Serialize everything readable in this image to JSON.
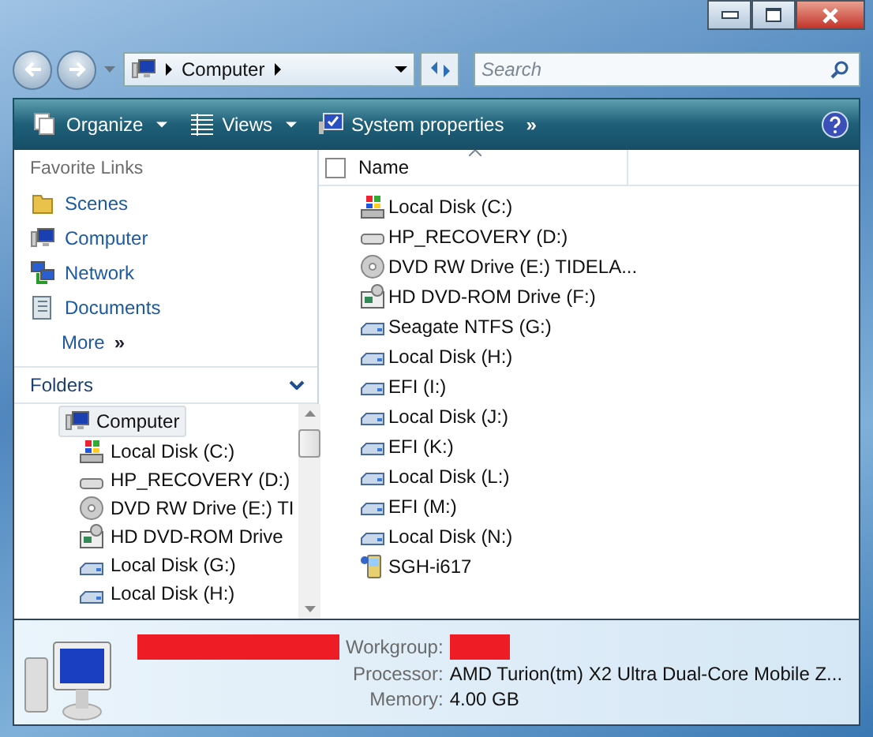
{
  "address_bar": {
    "path": [
      "Computer"
    ]
  },
  "search": {
    "placeholder": "Search"
  },
  "toolbar": [
    {
      "label": "Organize",
      "kind": "organize",
      "dropdown": true
    },
    {
      "label": "Views",
      "kind": "views",
      "dropdown": true
    },
    {
      "label": "System properties",
      "kind": "system",
      "dropdown": false
    },
    {
      "label": "»",
      "kind": "more",
      "dropdown": false
    }
  ],
  "favorite_links": {
    "title": "Favorite Links",
    "items": [
      {
        "label": "Scenes",
        "kind": "folder"
      },
      {
        "label": "Computer",
        "kind": "computer"
      },
      {
        "label": "Network",
        "kind": "network"
      },
      {
        "label": "Documents",
        "kind": "documents"
      }
    ],
    "more": {
      "label": "More",
      "chevron": "»"
    }
  },
  "folders": {
    "title": "Folders",
    "expanded": true,
    "tree": [
      {
        "label": "Computer",
        "kind": "computer",
        "selected": true,
        "children": [
          {
            "label": "Local Disk (C:)",
            "kind": "system-drive",
            "selected": false
          },
          {
            "label": "HP_RECOVERY (D:)",
            "kind": "drive",
            "selected": false
          },
          {
            "label": "DVD RW Drive (E:) TI",
            "kind": "dvd",
            "selected": false
          },
          {
            "label": "HD DVD-ROM Drive",
            "kind": "hddvd",
            "selected": false
          },
          {
            "label": "Local Disk (G:)",
            "kind": "usb-drive",
            "selected": false
          },
          {
            "label": "Local Disk (H:)",
            "kind": "usb-drive",
            "selected": false
          }
        ]
      }
    ]
  },
  "file_list": {
    "select_all_checked": false,
    "columns": [
      {
        "label": "Name",
        "sorted": true
      }
    ],
    "items": [
      {
        "name": "Local Disk (C:)",
        "kind": "system-drive"
      },
      {
        "name": "HP_RECOVERY (D:)",
        "kind": "drive"
      },
      {
        "name": "DVD RW Drive (E:) TIDELA...",
        "kind": "dvd"
      },
      {
        "name": "HD DVD-ROM Drive (F:)",
        "kind": "hddvd"
      },
      {
        "name": "Seagate NTFS (G:)",
        "kind": "usb-drive"
      },
      {
        "name": "Local Disk (H:)",
        "kind": "usb-drive"
      },
      {
        "name": "EFI (I:)",
        "kind": "usb-drive"
      },
      {
        "name": "Local Disk (J:)",
        "kind": "usb-drive"
      },
      {
        "name": "EFI (K:)",
        "kind": "usb-drive"
      },
      {
        "name": "Local Disk (L:)",
        "kind": "usb-drive"
      },
      {
        "name": "EFI (M:)",
        "kind": "usb-drive"
      },
      {
        "name": "Local Disk (N:)",
        "kind": "usb-drive"
      },
      {
        "name": "SGH-i617",
        "kind": "phone"
      }
    ]
  },
  "details": {
    "computer_name_redacted": true,
    "fields": [
      {
        "label": "Workgroup:",
        "redacted": true
      },
      {
        "label": "Processor:",
        "value": "AMD Turion(tm) X2 Ultra Dual-Core Mobile Z...",
        "redacted": false
      },
      {
        "label": "Memory:",
        "value": "4.00 GB",
        "redacted": false
      }
    ]
  }
}
